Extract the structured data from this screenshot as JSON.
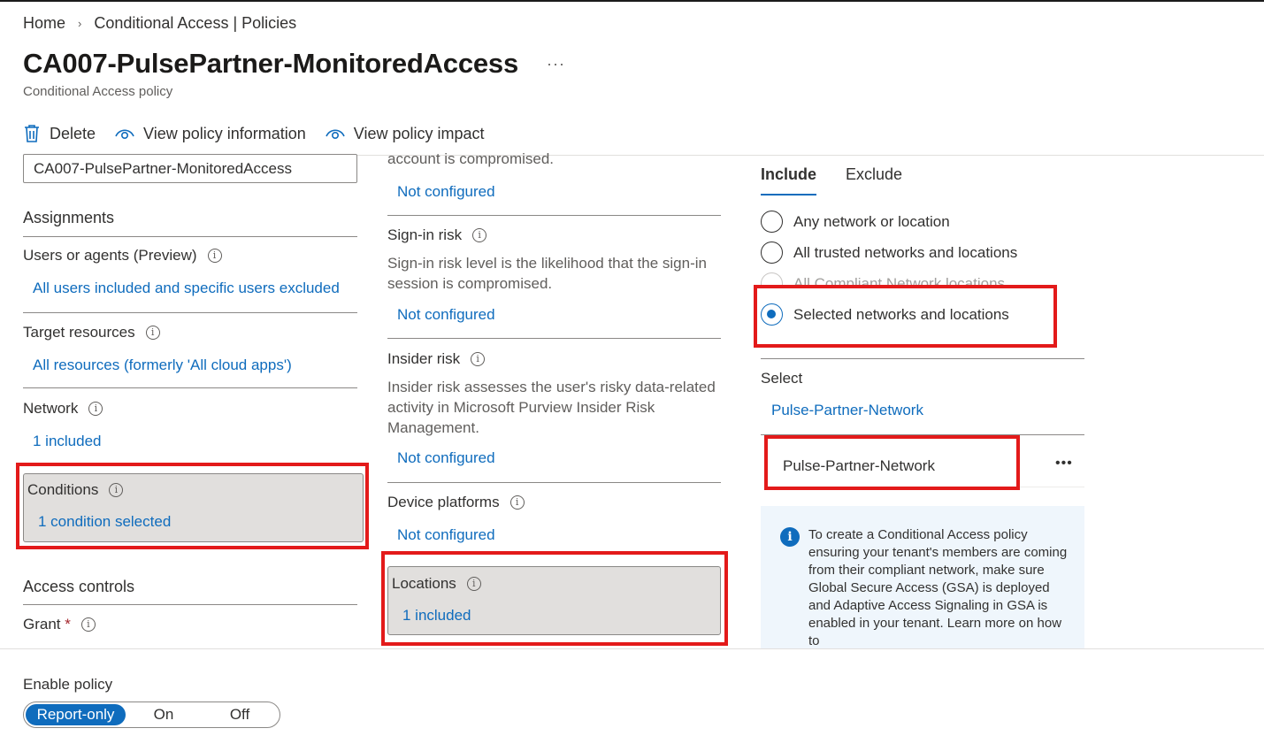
{
  "breadcrumb": {
    "home": "Home",
    "sep": "›",
    "current": "Conditional Access | Policies"
  },
  "header": {
    "title": "CA007-PulsePartner-MonitoredAccess",
    "more": "···",
    "subtitle": "Conditional Access policy"
  },
  "toolbar": {
    "delete": "Delete",
    "view_info": "View policy information",
    "view_impact": "View policy impact"
  },
  "left": {
    "name_value": "CA007-PulsePartner-MonitoredAccess",
    "assignments": "Assignments",
    "users_label": "Users or agents (Preview)",
    "users_value": "All users included and specific users excluded",
    "target_label": "Target resources",
    "target_value": "All resources (formerly 'All cloud apps')",
    "network_label": "Network",
    "network_value": "1 included",
    "conditions_label": "Conditions",
    "conditions_value": "1 condition selected",
    "access_controls": "Access controls",
    "grant_label": "Grant",
    "required_star": "*",
    "info_glyph": "i"
  },
  "middle": {
    "partial_desc": "account is compromised.",
    "user_risk_value": "Not configured",
    "signin_label": "Sign-in risk",
    "signin_desc": "Sign-in risk level is the likelihood that the sign-in session is compromised.",
    "signin_value": "Not configured",
    "insider_label": "Insider risk",
    "insider_desc": "Insider risk assesses the user's risky data-related activity in Microsoft Purview Insider Risk Management.",
    "insider_value": "Not configured",
    "device_label": "Device platforms",
    "device_value": "Not configured",
    "locations_label": "Locations",
    "locations_value": "1 included"
  },
  "right": {
    "tabs": [
      "Include",
      "Exclude"
    ],
    "options": [
      "Any network or location",
      "All trusted networks and locations",
      "All Compliant Network locations",
      "Selected networks and locations"
    ],
    "selected_option": "Selected networks and locations",
    "select_label": "Select",
    "select_link": "Pulse-Partner-Network",
    "item_name": "Pulse-Partner-Network",
    "item_more": "•••",
    "info_text": "To create a Conditional Access policy ensuring your tenant's members are coming from their compliant network, make sure Global Secure Access (GSA) is deployed and Adaptive Access Signaling in GSA is enabled in your tenant. Learn more on how to"
  },
  "footer": {
    "enable_label": "Enable policy",
    "options": [
      "Report-only",
      "On",
      "Off"
    ],
    "selected": "Report-only"
  },
  "colors": {
    "accent": "#0f6cbd",
    "highlight": "#e31a1a",
    "card": "#e1dfdd",
    "info_bg": "#eff6fc"
  }
}
